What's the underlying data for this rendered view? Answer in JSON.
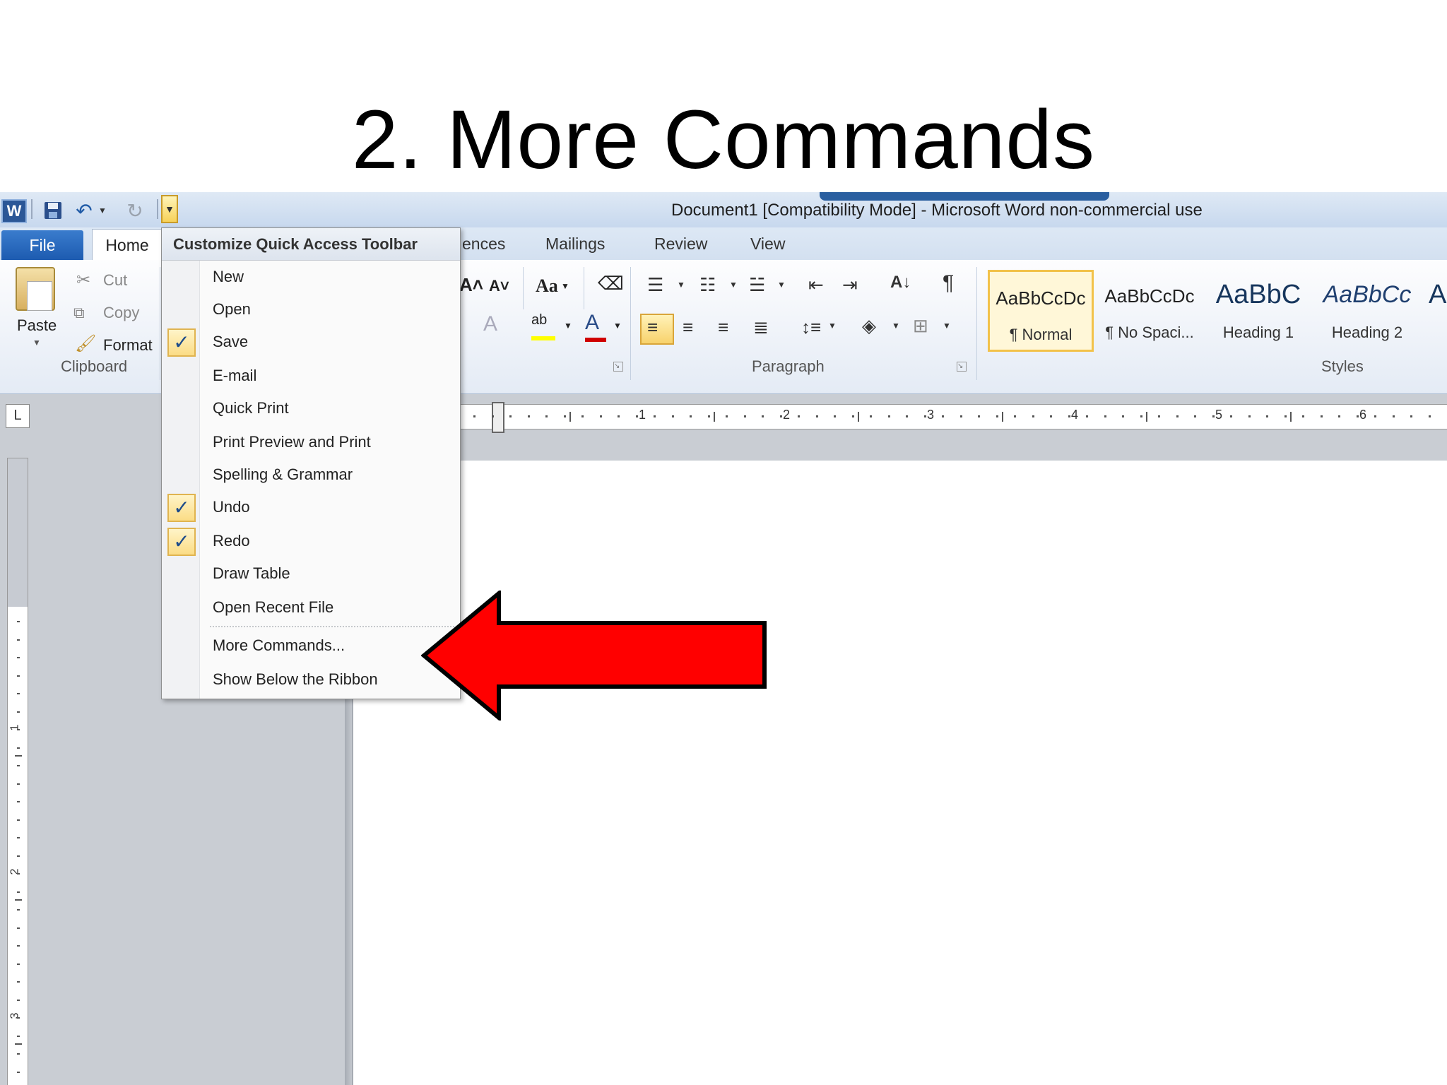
{
  "slide_title": "2. More Commands",
  "window": {
    "title": "Document1 [Compatibility Mode]  -  Microsoft Word non-commercial use"
  },
  "qat": {
    "word_icon": "W",
    "save_icon": "save-icon",
    "undo_icon": "undo-icon",
    "redo_icon": "redo-icon",
    "customize_icon": "customize-dropdown-icon"
  },
  "tabs": {
    "file": "File",
    "home": "Home",
    "references_partial": "ences",
    "mailings": "Mailings",
    "review": "Review",
    "view": "View"
  },
  "ribbon": {
    "clipboard": {
      "group": "Clipboard",
      "paste": "Paste",
      "cut": "Cut",
      "copy": "Copy",
      "format": "Format"
    },
    "font": {
      "change_case": "Aa"
    },
    "paragraph": {
      "group": "Paragraph"
    },
    "styles": {
      "group": "Styles",
      "items": [
        {
          "sample": "AaBbCcDc",
          "name": "¶ Normal"
        },
        {
          "sample": "AaBbCcDc",
          "name": "¶ No Spaci..."
        },
        {
          "sample": "AaBbC",
          "name": "Heading 1"
        },
        {
          "sample": "AaBbCc",
          "name": "Heading 2"
        },
        {
          "sample": "A",
          "name": ""
        }
      ]
    }
  },
  "ruler": {
    "numbers": [
      "1",
      "2",
      "3",
      "4",
      "5",
      "6"
    ],
    "vnumbers": [
      "1",
      "2",
      "3"
    ]
  },
  "menu": {
    "header": "Customize Quick Access Toolbar",
    "items": [
      {
        "label": "New",
        "checked": false
      },
      {
        "label": "Open",
        "checked": false
      },
      {
        "label": "Save",
        "checked": true
      },
      {
        "label": "E-mail",
        "checked": false
      },
      {
        "label": "Quick Print",
        "checked": false
      },
      {
        "label": "Print Preview and Print",
        "checked": false
      },
      {
        "label": "Spelling & Grammar",
        "checked": false
      },
      {
        "label": "Undo",
        "checked": true
      },
      {
        "label": "Redo",
        "checked": true
      },
      {
        "label": "Draw Table",
        "checked": false
      },
      {
        "label": "Open Recent File",
        "checked": false
      }
    ],
    "more_commands": "More Commands...",
    "show_below": "Show Below the Ribbon",
    "check_mark": "✓"
  },
  "colors": {
    "arrow": "#ff0000",
    "file_tab": "#1d5bb0",
    "highlight": "#f8d26c"
  }
}
